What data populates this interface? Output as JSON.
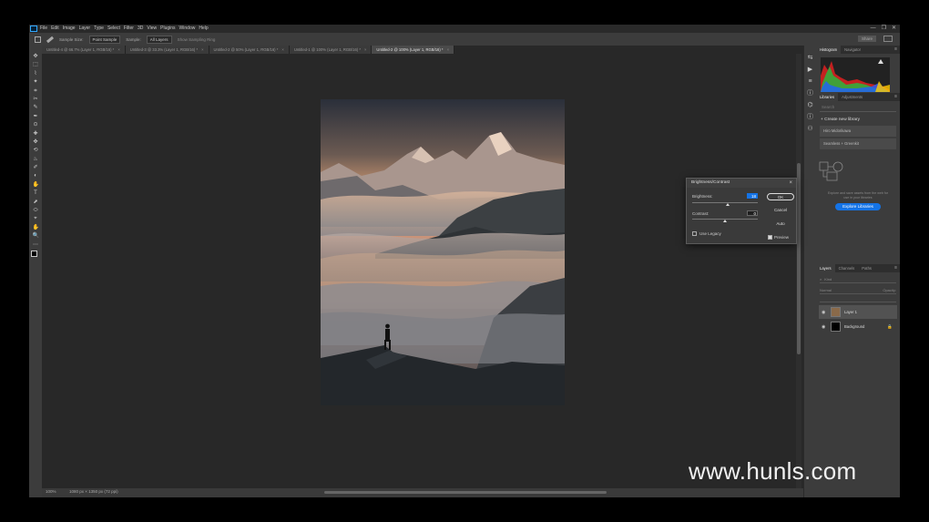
{
  "menubar": {
    "items": [
      "File",
      "Edit",
      "Image",
      "Layer",
      "Type",
      "Select",
      "Filter",
      "3D",
      "View",
      "Plugins",
      "Window",
      "Help"
    ],
    "window_controls": [
      "—",
      "❐",
      "✕"
    ]
  },
  "options": {
    "sample_size_label": "Sample Size:",
    "sample_size_value": "Point Sample",
    "sample_label": "Sample:",
    "sample_value": "All Layers",
    "show_ring": "Show Sampling Ring",
    "share": "Share"
  },
  "tabs": [
    {
      "label": "Untitled-4 @ 66.7% (Layer 1, RGB/16) *",
      "active": false
    },
    {
      "label": "Untitled-3 @ 33.3% (Layer 1, RGB/16) *",
      "active": false
    },
    {
      "label": "Untitled-2 @ 50% (Layer 1, RGB/16) *",
      "active": false
    },
    {
      "label": "Untitled-1 @ 100% (Layer 1, RGB/16) *",
      "active": false
    },
    {
      "label": "Untitled-2 @ 100% (Layer 1, RGB/16) *",
      "active": true
    }
  ],
  "tools": [
    "✥",
    "⬚",
    "⌇",
    "✦",
    "⌗",
    "✂",
    "✎",
    "✒",
    "⊙",
    "✚",
    "✤",
    "⟲",
    "♨",
    "✐",
    "◐",
    "✋",
    "T",
    "⬈",
    "⬭",
    "⌖",
    "✋",
    "🔍",
    "⋯"
  ],
  "statusbar": {
    "zoom": "100%",
    "info": "1080 px × 1350 px (72 ppi)"
  },
  "icon_strip": [
    "⇆",
    "▶",
    "≡",
    "ⓘ",
    "⌬",
    "ⓘ",
    "⚇"
  ],
  "histogram": {
    "tabs": [
      "Histogram",
      "Navigator"
    ],
    "warning_icon": "warning-icon"
  },
  "libraries": {
    "tabs": [
      "Libraries",
      "Adjustments"
    ],
    "search_placeholder": "Search",
    "create": "+ Create new library",
    "items": [
      "Hiro Midorikawa",
      "Seamless + Greenkit"
    ],
    "message": "Explore and save assets from the web for use in your libraries",
    "explore_button": "Explore Libraries"
  },
  "layers": {
    "tabs": [
      "Layers",
      "Channels",
      "Paths"
    ],
    "filter_label": "Kind",
    "blend_mode": "Normal",
    "opacity_label": "Opacity:",
    "items": [
      {
        "name": "Layer 1",
        "selected": true,
        "lock": "",
        "thumb": "#8a6a4a"
      },
      {
        "name": "Background",
        "selected": false,
        "lock": "🔒",
        "thumb": "#000000"
      }
    ]
  },
  "dialog": {
    "title": "Brightness/Contrast",
    "brightness_label": "Brightness:",
    "brightness_value": "18",
    "brightness_pos": 0.54,
    "contrast_label": "Contrast:",
    "contrast_value": "0",
    "contrast_pos": 0.5,
    "legacy_label": "Use Legacy",
    "ok": "OK",
    "cancel": "Cancel",
    "auto": "Auto",
    "preview": "Preview"
  },
  "watermark": "www.hunls.com"
}
